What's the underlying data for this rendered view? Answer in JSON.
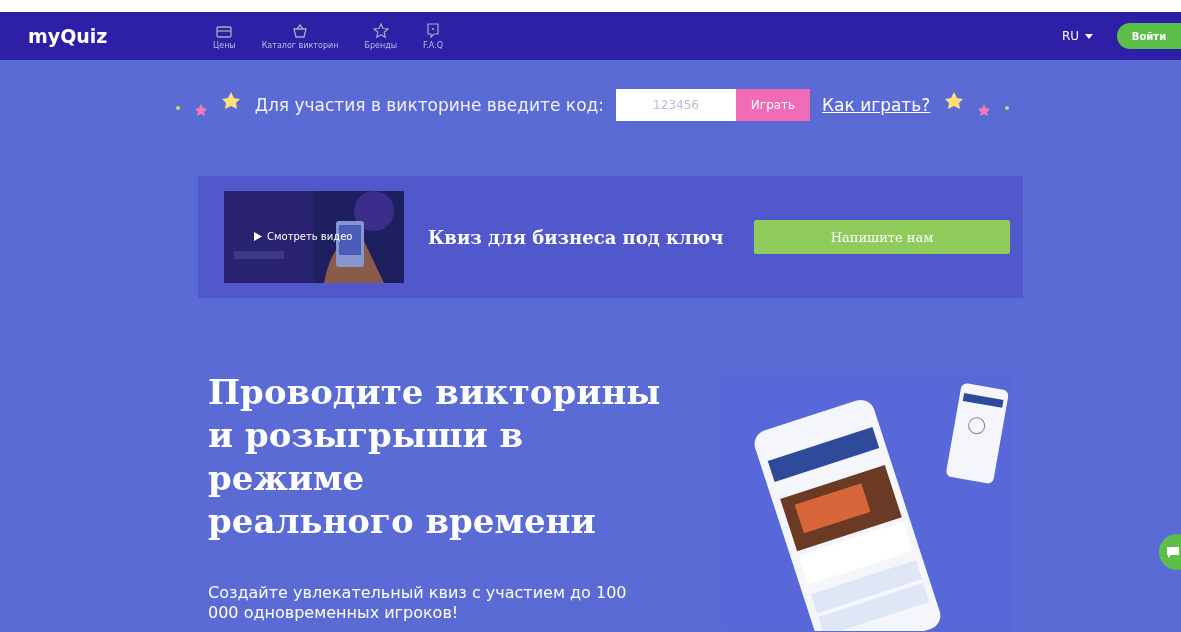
{
  "header": {
    "logo": "myQuiz",
    "nav": [
      {
        "label": "Цены"
      },
      {
        "label": "Каталог викторин"
      },
      {
        "label": "Бренды"
      },
      {
        "label": "F.A.Q"
      }
    ],
    "language": "RU",
    "login": "Войти"
  },
  "code_bar": {
    "prompt": "Для участия в викторине введите код:",
    "placeholder": "123456",
    "play": "Играть",
    "how_to": "Как играть?"
  },
  "banner": {
    "video_button": "Смотреть видео",
    "title": "Квиз для бизнеса под ключ",
    "contact": "Напишите нам"
  },
  "hero": {
    "headline": [
      "Проводите викторины",
      "и розыгрыши в",
      "режиме",
      "реального времени"
    ],
    "subtitle": "Создайте увлекательный квиз с участием до 100 000 одновременных игроков!"
  }
}
